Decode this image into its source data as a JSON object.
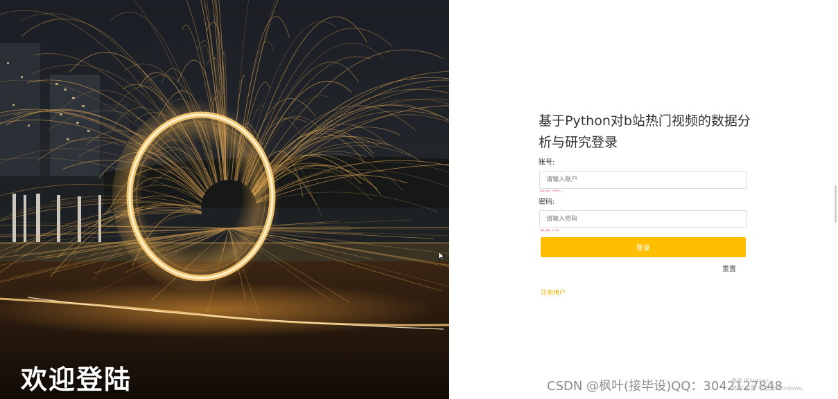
{
  "hero": {
    "title": "欢迎登陆",
    "image": "steel-wool-fire-ring-night-cityscape"
  },
  "form": {
    "title": "基于Python对b站热门视频的数据分析与研究登录",
    "account_label": "账号:",
    "account_placeholder": "请输入账户",
    "account_hint": "请输入账户，字母开头",
    "password_label": "密码:",
    "password_placeholder": "请输入密码",
    "password_hint": "请输入密码，6-16位",
    "login_button": "登录",
    "reset_button": "重置",
    "register_link": "注册用户"
  },
  "overlay": {
    "watermark": "CSDN @枫叶(接毕设)QQ：3042127848",
    "activation_line1": "激活 Windows",
    "activation_line2": "转到\"设置\"以激活 Windows。"
  },
  "colors": {
    "accent": "#ffbe00",
    "register_link": "#f0b000",
    "hint": "#e4566b",
    "text": "#333333"
  }
}
